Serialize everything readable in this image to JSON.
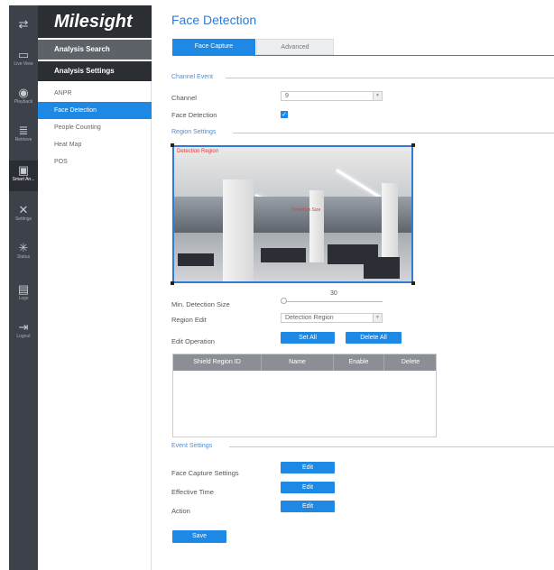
{
  "app": {
    "logo": "Milesight"
  },
  "rail": [
    {
      "icon": "sliders-icon",
      "glyph": "⇄",
      "label": ""
    },
    {
      "icon": "live-view-icon",
      "glyph": "▭",
      "label": "Live View"
    },
    {
      "icon": "playback-icon",
      "glyph": "◉",
      "label": "Playback"
    },
    {
      "icon": "retrieve-icon",
      "glyph": "≣",
      "label": "Retrieve"
    },
    {
      "icon": "smart-analysis-icon",
      "glyph": "▣",
      "label": "Smart An..."
    },
    {
      "icon": "settings-icon",
      "glyph": "✕",
      "label": "Settings"
    },
    {
      "icon": "status-icon",
      "glyph": "✳",
      "label": "Status"
    },
    {
      "icon": "logs-icon",
      "glyph": "▤",
      "label": "Logs"
    },
    {
      "icon": "logout-icon",
      "glyph": "⇥",
      "label": "Logout"
    }
  ],
  "submenu": {
    "analysis_search": "Analysis Search",
    "analysis_settings": "Analysis Settings",
    "items": [
      "ANPR",
      "Face Detection",
      "People Counting",
      "Heat Map",
      "POS"
    ]
  },
  "page": {
    "title": "Face Detection",
    "tabs": [
      "Face Capture",
      "Advanced"
    ]
  },
  "channel_event": {
    "section": "Channel Event",
    "channel_label": "Channel",
    "channel_value": "9",
    "face_detection_label": "Face Detection",
    "face_detection_checked": true
  },
  "region_settings": {
    "section": "Region Settings",
    "video_region_label": "Detection Region",
    "video_face_label": "Detection Size",
    "min_size_label": "Min. Detection Size",
    "min_size_value": "30",
    "region_edit_label": "Region Edit",
    "region_edit_value": "Detection Region",
    "edit_operation_label": "Edit Operation",
    "set_all": "Set All",
    "delete_all": "Delete All",
    "table_headers": [
      "Shield Region ID",
      "Name",
      "Enable",
      "Delete"
    ]
  },
  "event_settings": {
    "section": "Event Settings",
    "rows": [
      {
        "label": "Face Capture Settings",
        "button": "Edit"
      },
      {
        "label": "Effective Time",
        "button": "Edit"
      },
      {
        "label": "Action",
        "button": "Edit"
      }
    ]
  },
  "save": "Save",
  "colors": {
    "accent": "#1e88e5",
    "rail_bg": "#3d4149",
    "header_bg": "#2b2e33"
  }
}
